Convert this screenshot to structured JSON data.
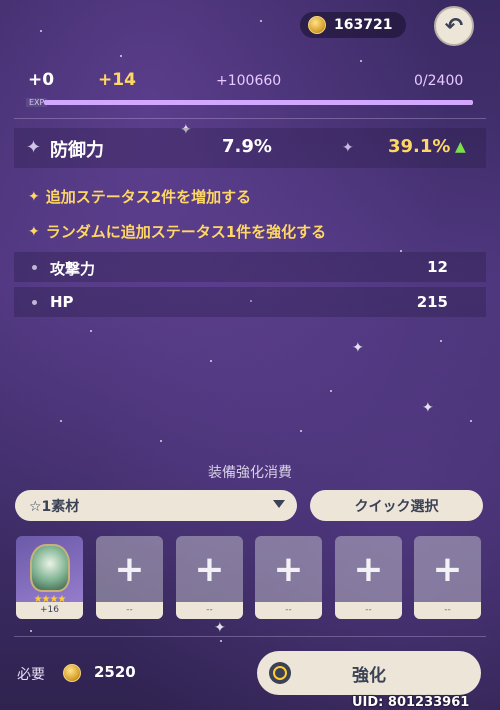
{
  "currency": {
    "amount": "163721"
  },
  "level": {
    "current": "+0",
    "added": "+14",
    "exp_gain": "+100660",
    "exp_progress": "0/2400",
    "exp_label": "EXP",
    "exp_fill": 1.0
  },
  "main_stat": {
    "name": "防御力",
    "from": "7.9%",
    "to": "39.1%"
  },
  "bonuses": [
    "追加ステータス2件を増加する",
    "ランダムに追加ステータス1件を強化する"
  ],
  "sub_stats": [
    {
      "name": "攻撃力",
      "value": "12"
    },
    {
      "name": "HP",
      "value": "215"
    }
  ],
  "material": {
    "title": "装備強化消費",
    "filter_label": "☆1素材",
    "quick_select_label": "クイック選択",
    "slots": [
      {
        "filled": true,
        "stars": "★★★★",
        "level": "+16"
      },
      {
        "filled": false,
        "foot": "--"
      },
      {
        "filled": false,
        "foot": "--"
      },
      {
        "filled": false,
        "foot": "--"
      },
      {
        "filled": false,
        "foot": "--"
      },
      {
        "filled": false,
        "foot": "--"
      }
    ]
  },
  "footer": {
    "required_label": "必要",
    "required_cost": "2520",
    "enhance_label": "強化",
    "uid": "UID: 801233961"
  },
  "colors": {
    "accent_gold": "#ffd764",
    "button_bg": "#ece5d8",
    "button_text": "#3b4255",
    "up_arrow": "#7be04a"
  }
}
